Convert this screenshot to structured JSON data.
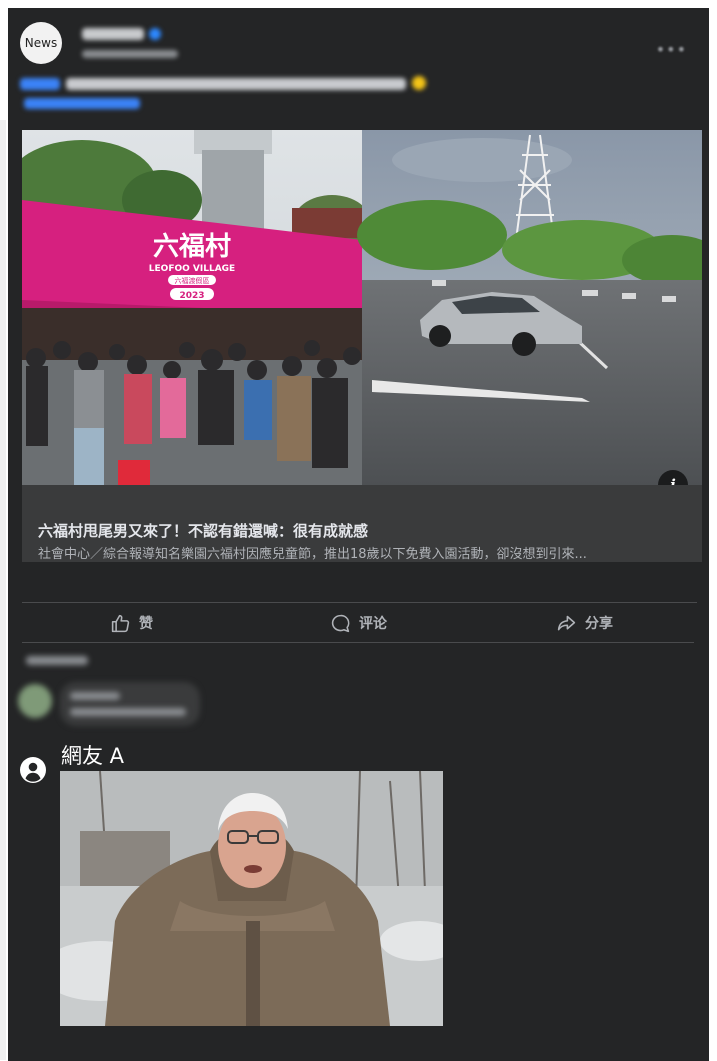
{
  "post": {
    "avatar_text": "News",
    "menu_icon": "more-horizontal-icon"
  },
  "link_preview": {
    "info_icon": "info-icon",
    "title": "六福村甩尾男又來了！不認有錯還喊：很有成就感",
    "description": "社會中心／綜合報導知名樂園六福村因應兒童節，推出18歲以下免費入園活動，卻沒想到引來...",
    "photo_left_sign": "六福村",
    "photo_left_sign_sub": "LEOFOO VILLAGE",
    "photo_left_sign_small": "六福渡假區",
    "photo_left_sign_year": "2023"
  },
  "actions": {
    "like_label": "赞",
    "comment_label": "评论",
    "share_label": "分享",
    "like_icon": "thumbs-up-icon",
    "comment_icon": "comment-bubble-icon",
    "share_icon": "share-arrow-icon"
  },
  "comment": {
    "author": "網友 A",
    "author_icon": "user-avatar-icon"
  },
  "colors": {
    "background": "#242526",
    "card": "#3a3b3c",
    "text": "#e4e6eb",
    "muted": "#b0b3b8",
    "verified": "#1877f2"
  }
}
